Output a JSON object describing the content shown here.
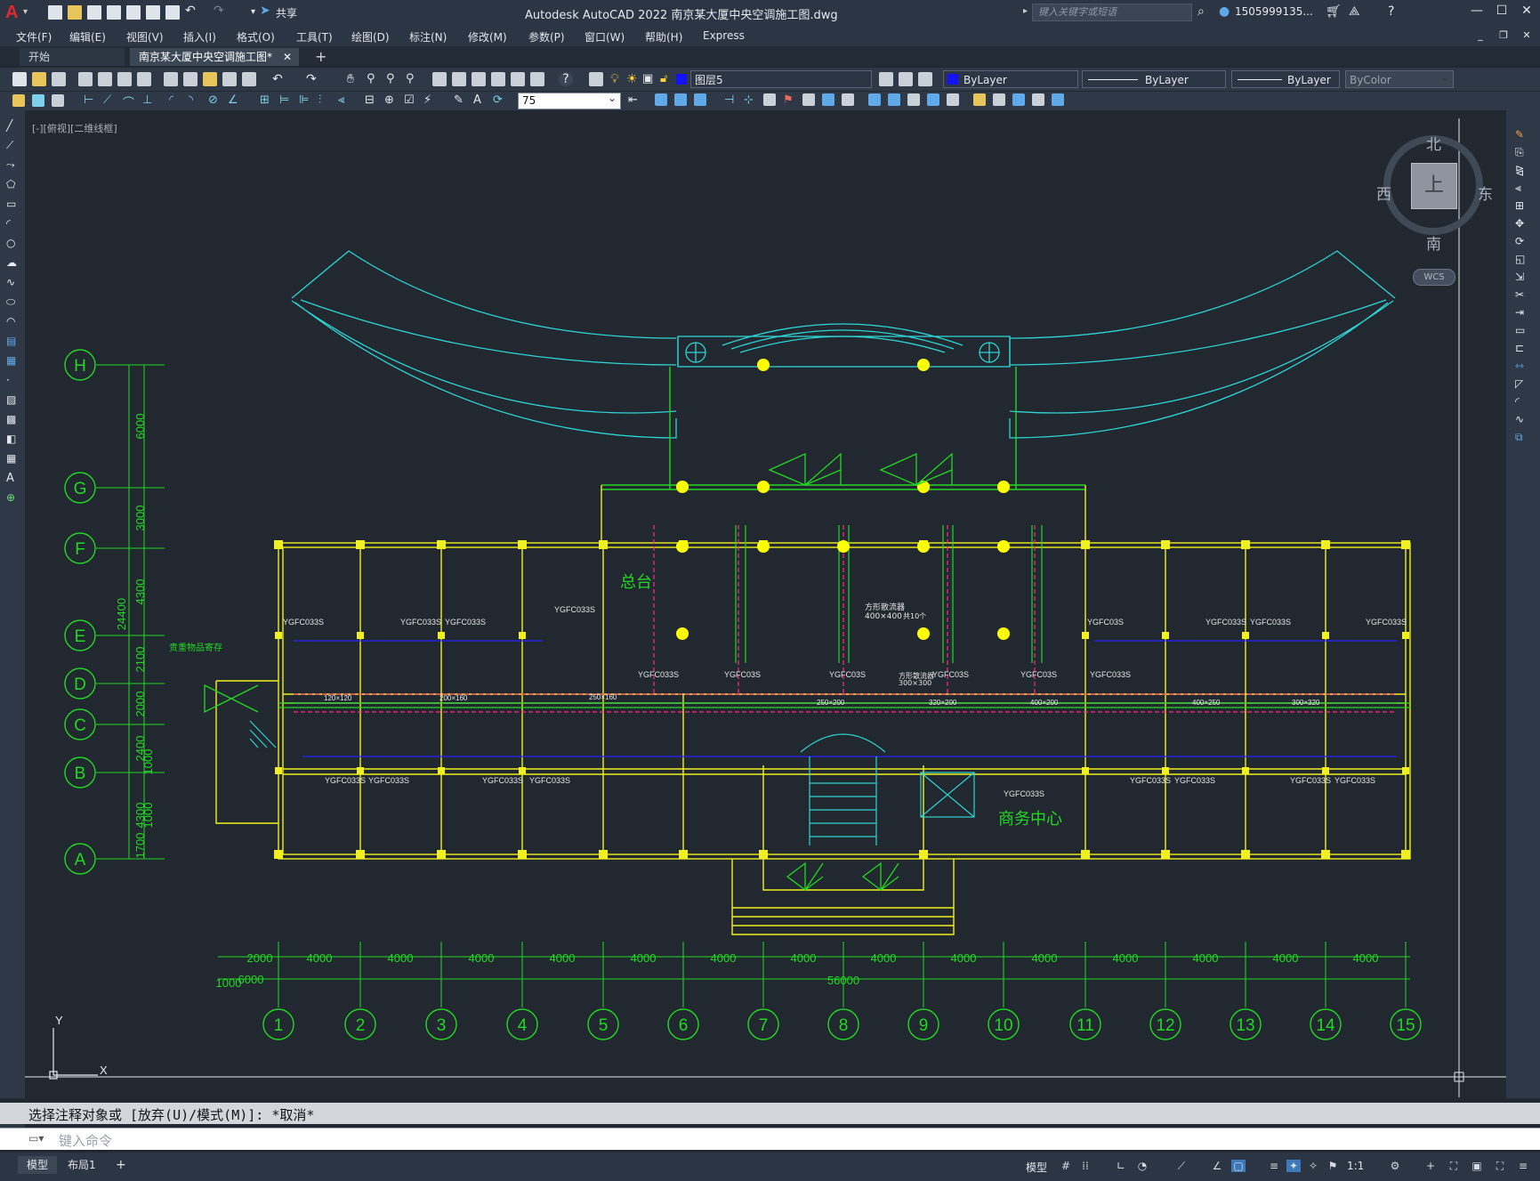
{
  "app": {
    "logo": "A",
    "title": "Autodesk AutoCAD 2022    南京某大厦中央空调施工图.dwg",
    "share_label": "共享",
    "search_placeholder": "键入关键字或短语",
    "user": "1505999135...",
    "accent": "#e0282e"
  },
  "menus": [
    "文件(F)",
    "编辑(E)",
    "视图(V)",
    "插入(I)",
    "格式(O)",
    "工具(T)",
    "绘图(D)",
    "标注(N)",
    "修改(M)",
    "参数(P)",
    "窗口(W)",
    "帮助(H)",
    "Express"
  ],
  "tabs": [
    {
      "label": "开始",
      "active": false
    },
    {
      "label": "南京某大厦中央空调施工图*",
      "active": true
    }
  ],
  "toolbar": {
    "layer_value": "图层5",
    "color_value": "ByLayer",
    "linetype_value": "ByLayer",
    "lineweight_value": "ByLayer",
    "plotstyle_value": "ByColor",
    "dimscale_value": "75"
  },
  "viewport_label": "[-][俯视][二维线框]",
  "viewcube": {
    "north": "北",
    "south": "南",
    "east": "东",
    "west": "西",
    "top": "上",
    "wcs": "WCS"
  },
  "drawing": {
    "row_axes": [
      {
        "label": "H"
      },
      {
        "label": "G"
      },
      {
        "label": "F"
      },
      {
        "label": "E"
      },
      {
        "label": "D"
      },
      {
        "label": "C"
      },
      {
        "label": "B"
      },
      {
        "label": "A"
      }
    ],
    "row_dims": [
      "6000",
      "3000",
      "4300",
      "2100",
      "2000",
      "2400",
      "4300",
      "1700"
    ],
    "row_dims_secondary": [
      "24400",
      "1000",
      "1000"
    ],
    "col_axes": [
      "1",
      "2",
      "3",
      "4",
      "5",
      "6",
      "7",
      "8",
      "9",
      "10",
      "11",
      "12",
      "13",
      "14",
      "15"
    ],
    "col_dims": [
      "2000",
      "4000",
      "4000",
      "4000",
      "4000",
      "4000",
      "4000",
      "4000",
      "4000",
      "4000",
      "4000",
      "4000",
      "4000",
      "4000",
      "4000"
    ],
    "col_dims_secondary": [
      "1000",
      "6000"
    ],
    "total_dim": "56000",
    "room_labels": [
      {
        "text": "总台"
      },
      {
        "text": "商务中心"
      },
      {
        "text": "贵重物品寄存"
      }
    ],
    "annotations": [
      "YGFC033S",
      "YGFC033S",
      "YGFC033S",
      "YGFC033S",
      "YGFC033S",
      "YGFC03S",
      "YGFC03S",
      "YGFC03S",
      "YGFC03S",
      "YGFC03S",
      "YGFC033S",
      "YGFC033S",
      "YGFC033S",
      "YGFC033S",
      "YGFC033S",
      "YGFC033S",
      "YGFC033S",
      "YGFC033S",
      "YGFC033S",
      "YGFC033S",
      "YGFC033S",
      "YGFC033S",
      "YGFC033S"
    ],
    "duct_notes": [
      "方形散流器",
      "400×400",
      "共10个",
      "方形散流器",
      "300×300"
    ],
    "duct_sizes": [
      "120×120",
      "200×160",
      "250×160",
      "250×200",
      "320×200",
      "400×200",
      "400×250",
      "300×320"
    ],
    "ucs_x": "X",
    "ucs_y": "Y"
  },
  "command": {
    "history": "选择注释对象或 [放弃(U)/模式(M)]: *取消*",
    "placeholder": "键入命令"
  },
  "layout_tabs": [
    "模型",
    "布局1"
  ],
  "status": {
    "model_label": "模型",
    "scale": "1:1"
  }
}
